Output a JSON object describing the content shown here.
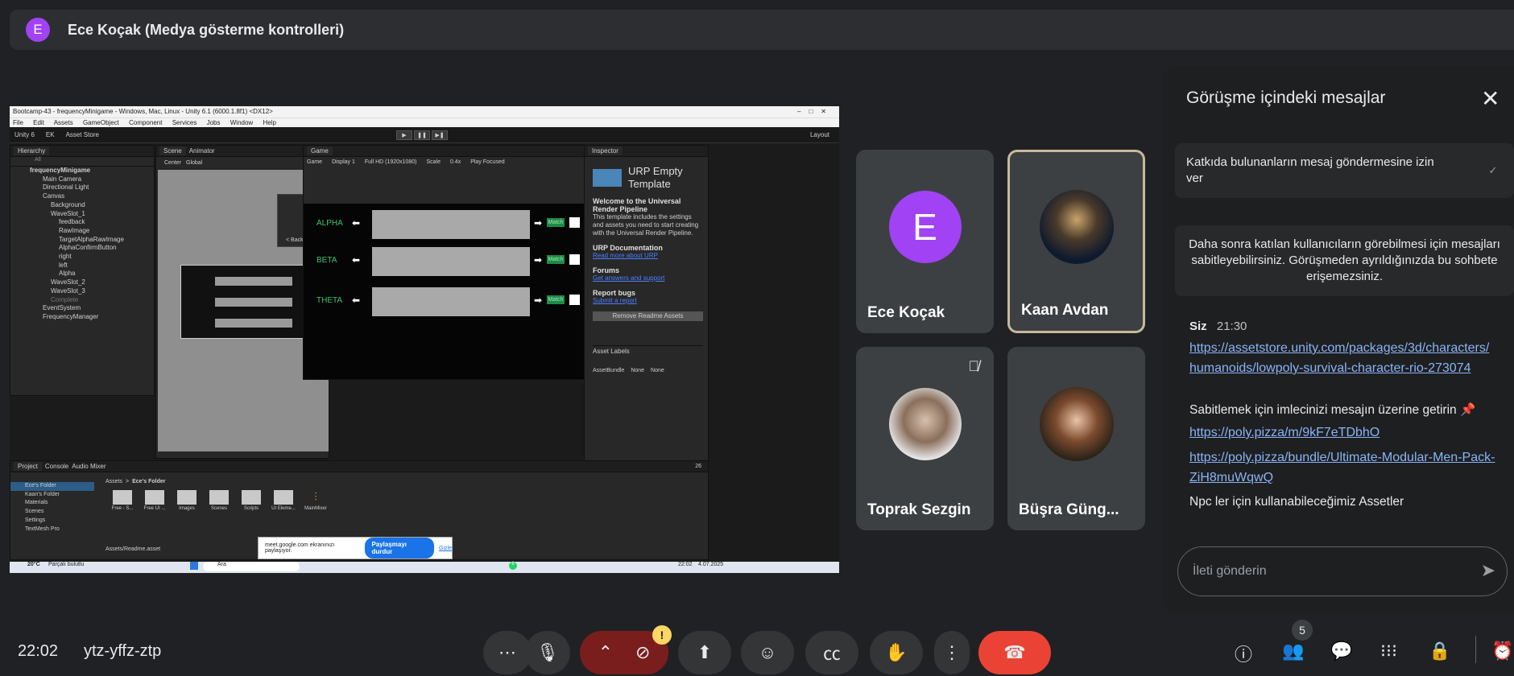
{
  "presenter": {
    "initial": "E",
    "title": "Ece Koçak (Medya gösterme kontrolleri)",
    "avatar_color": "#a142f4"
  },
  "unity": {
    "window_title": "Bootcamp-43 - frequencyMinigame - Windows, Mac, Linux - Unity 6.1 (6000.1.8f1) <DX12>",
    "menu": [
      "File",
      "Edit",
      "Assets",
      "GameObject",
      "Component",
      "Services",
      "Jobs",
      "Window",
      "Help"
    ],
    "toolbar": {
      "logo": "Unity 6",
      "account": "EK",
      "store": "Asset Store",
      "layout": "Layout"
    },
    "hierarchy_tab": "Hierarchy",
    "hierarchy_search": "All",
    "hierarchy": [
      "frequencyMinigame",
      "Main Camera",
      "Directional Light",
      "Canvas",
      "Background",
      "WaveSlot_1",
      "feedback",
      "RawImage",
      "TargetAlphaRawImage",
      "AlphaConfirmButton",
      "right",
      "left",
      "Alpha",
      "WaveSlot_2",
      "WaveSlot_3",
      "Complete",
      "EventSystem",
      "FrequencyManager"
    ],
    "scene_tab": "Scene",
    "animator_tab": "Animator",
    "scene_pivot": "Center",
    "scene_space": "Global",
    "scene_back": "< Back",
    "game_tab": "Game",
    "game_bar": {
      "mode": "Game",
      "display": "Display 1",
      "resolution": "Full HD (1920x1080)",
      "scale_label": "Scale",
      "scale": "0.4x",
      "play": "Play Focused"
    },
    "game_rows": [
      {
        "label": "ALPHA",
        "match": "Match"
      },
      {
        "label": "BETA",
        "match": "Match"
      },
      {
        "label": "THETA",
        "match": "Match"
      }
    ],
    "inspector_tab": "Inspector",
    "inspector": {
      "title": "URP Empty Template",
      "welcome": "Welcome to the Universal Render Pipeline",
      "welcome_text": "This template includes the settings and assets you need to start creating with the Universal Render Pipeline.",
      "doc_h": "URP Documentation",
      "doc_link": "Read more about URP",
      "forums_h": "Forums",
      "forums_link": "Get answers and support",
      "bugs_h": "Report bugs",
      "bugs_link": "Submit a report",
      "remove_btn": "Remove Readme Assets",
      "labels": "Asset Labels",
      "bundle": "AssetBundle",
      "bundle_val": "None",
      "variant_val": "None"
    },
    "project_tab": "Project",
    "console_tab": "Console",
    "audio_tab": "Audio Mixer",
    "project_tree": [
      "Ece's Folder",
      "Kaan's Folder",
      "Materials",
      "Scenes",
      "Settings",
      "TextMesh Pro"
    ],
    "breadcrumb": {
      "root": "Assets",
      "sep": ">",
      "folder": "Ece's Folder"
    },
    "folders": [
      "Free - S...",
      "Free UI ...",
      "Images",
      "Scenes",
      "Scripts",
      "UI Eleme...",
      "MainMixer"
    ],
    "asset_path": "Assets/Readme.asset",
    "asset_count": "26",
    "share_popup": {
      "text": "meet.google.com ekranınızı paylaşıyor.",
      "stop": "Paylaşmayı durdur",
      "hide": "Gizle"
    },
    "taskbar": {
      "temp": "20°C",
      "weather": "Parçalı bulutlu",
      "search": "Ara",
      "time": "22:02",
      "date": "4.07.2025",
      "notif": "6"
    }
  },
  "participants": [
    {
      "name": "Ece Koçak",
      "initial": "E",
      "color": "#a142f4"
    },
    {
      "name": "Kaan Avdan"
    },
    {
      "name": "Toprak Sezgin",
      "muted": true
    },
    {
      "name": "Büşra Güng..."
    }
  ],
  "chat": {
    "title": "Görüşme içindeki mesajlar",
    "allow_label": "Katkıda bulunanların mesaj göndermesine izin ver",
    "info": "Daha sonra katılan kullanıcıların görebilmesi için mesajları sabitleyebilirsiniz. Görüşmeden ayrıldığınızda bu sohbete erişemezsiniz.",
    "sender": "Siz",
    "time": "21:30",
    "link1": "https://assetstore.unity.com/packages/3d/characters/humanoids/lowpoly-survival-character-rio-273074",
    "pin_hint": "Sabitlemek için imlecinizi mesajın üzerine getirin",
    "link2": "https://poly.pizza/m/9kF7eTDbhO",
    "link3": "https://poly.pizza/bundle/Ultimate-Modular-Men-Pack-ZiH8muWqwQ",
    "note": "Npc ler için kullanabileceğimiz Assetler",
    "placeholder": "İleti gönderin"
  },
  "bottom": {
    "clock": "22:02",
    "code": "ytz-yffz-ztp",
    "warning_badge": "!",
    "people_count": "5"
  }
}
